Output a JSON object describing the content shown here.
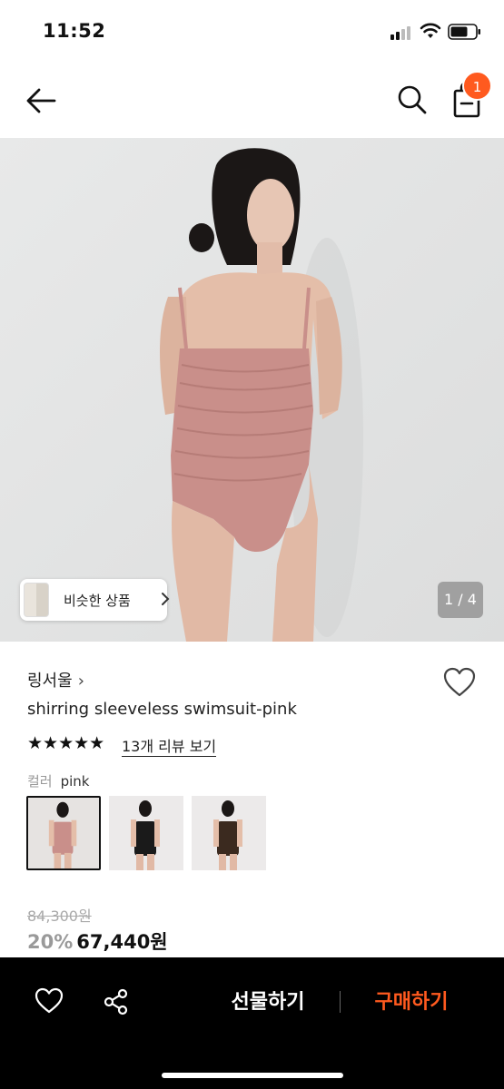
{
  "status_bar": {
    "time": "11:52"
  },
  "header": {
    "back_icon": "arrow-left-icon",
    "search_icon": "search-icon",
    "bag_icon": "shopping-bag-icon",
    "cart_count": "1"
  },
  "hero": {
    "similar_label": "비슷한 상품",
    "page_indicator": "1 / 4",
    "image_alt": "model wearing pink shirring swimsuit"
  },
  "product": {
    "brand": "링서울",
    "brand_chevron": "›",
    "name": "shirring sleeveless swimsuit-pink",
    "stars": "★★★★★",
    "rating": 5,
    "review_link": "13개 리뷰 보기",
    "option_label": "컬러",
    "option_value": "pink",
    "swatches": [
      {
        "name": "pink",
        "selected": true
      },
      {
        "name": "black",
        "selected": false
      },
      {
        "name": "brown",
        "selected": false
      }
    ],
    "original_price": "84,300원",
    "discount": "20%",
    "sale_price": "67,440원"
  },
  "bottom_bar": {
    "gift_label": "선물하기",
    "buy_label": "구매하기"
  },
  "colors": {
    "accent": "#ff5a1f",
    "bottom_bar_bg": "#000000",
    "hero_bg": "#e3e4e4",
    "swimsuit_pink": "#c98f8a"
  }
}
